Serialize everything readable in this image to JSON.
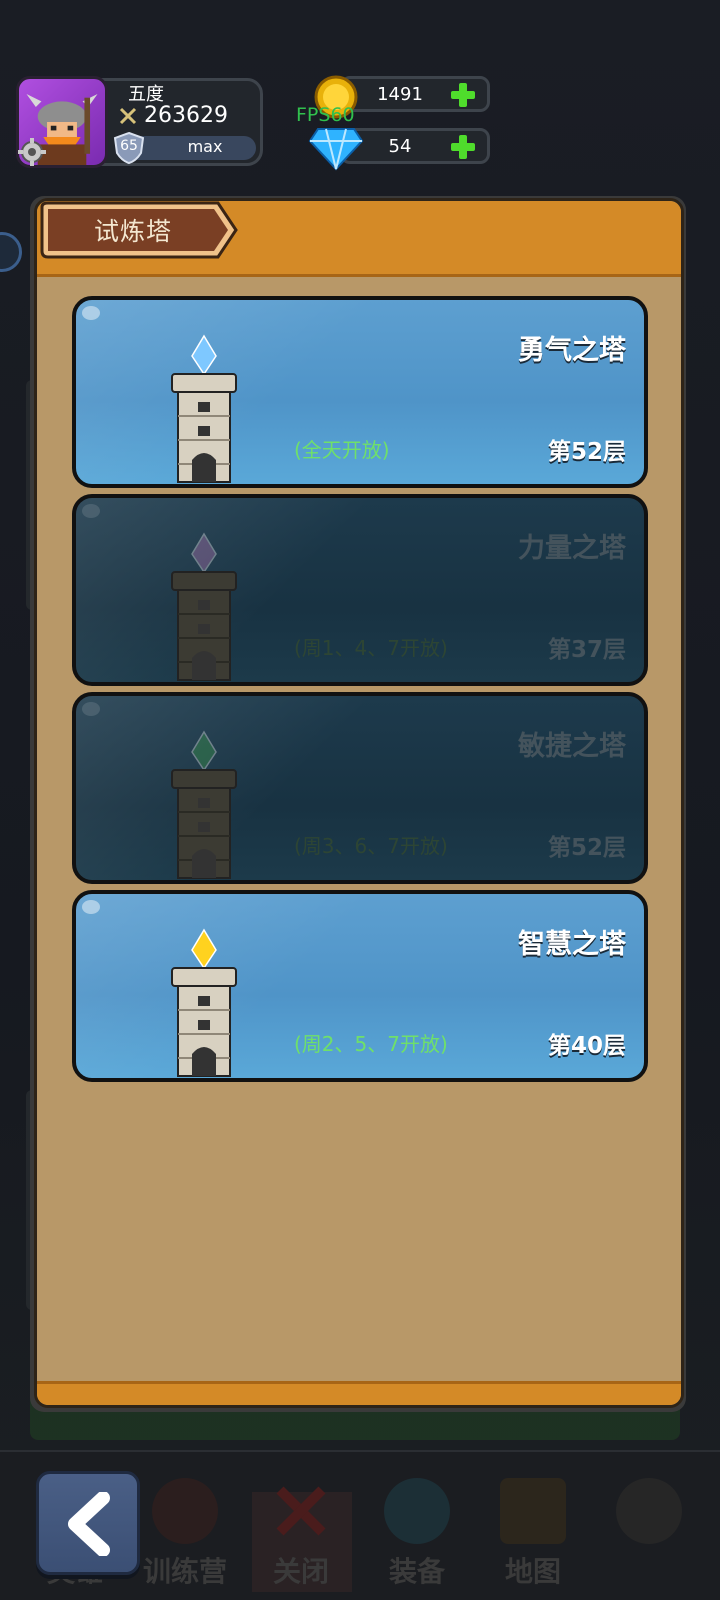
{
  "player": {
    "name": "五度",
    "power": "263629",
    "level": "65",
    "level_status": "max"
  },
  "resources": {
    "coins": "1491",
    "gems": "54",
    "fps": "FPS60"
  },
  "panel": {
    "title": "试炼塔"
  },
  "towers": [
    {
      "name": "勇气之塔",
      "schedule": "(全天开放)",
      "floor": "第52层",
      "open": true,
      "crystal_color": "#7ec8ff"
    },
    {
      "name": "力量之塔",
      "schedule": "(周1、4、7开放)",
      "floor": "第37层",
      "open": false,
      "crystal_color": "#c27dbf"
    },
    {
      "name": "敏捷之塔",
      "schedule": "(周3、6、7开放)",
      "floor": "第52层",
      "open": false,
      "crystal_color": "#3fa64a"
    },
    {
      "name": "智慧之塔",
      "schedule": "(周2、5、7开放)",
      "floor": "第40层",
      "open": true,
      "crystal_color": "#ffd21f"
    }
  ],
  "bottom_nav": {
    "items": [
      "英雄",
      "训练营",
      "关闭",
      "装备",
      "地图",
      ""
    ]
  },
  "icons": {
    "back": "chevron-left-icon",
    "settings": "gear-icon",
    "add": "plus-icon",
    "coin": "coin-icon",
    "gem": "diamond-icon"
  }
}
